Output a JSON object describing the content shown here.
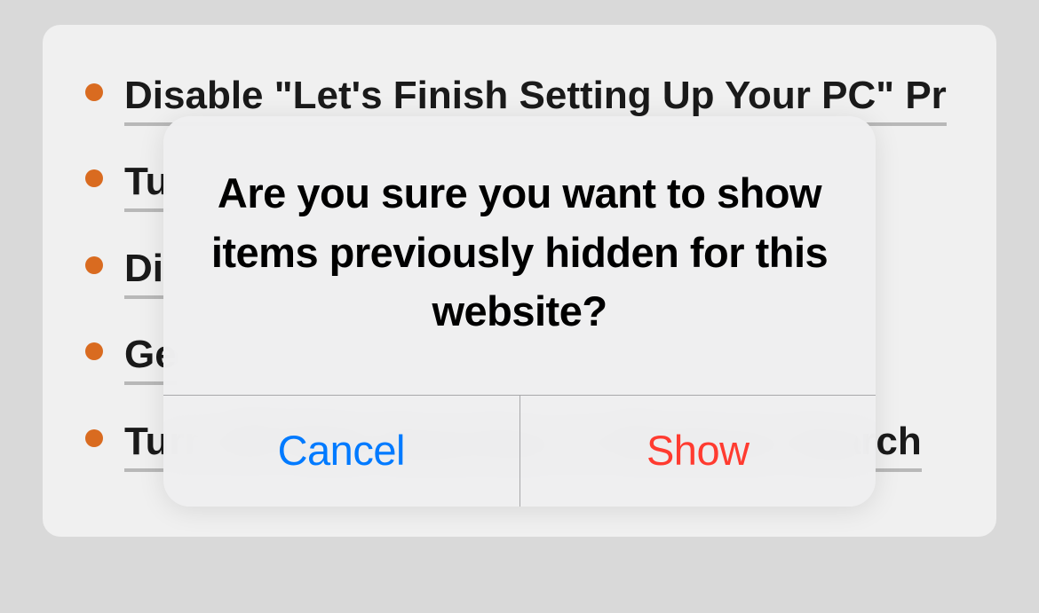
{
  "list": {
    "items": [
      {
        "text": "Disable \"Let's Finish Setting Up Your PC\" Pr"
      },
      {
        "text": "Tu"
      },
      {
        "text": "Di"
      },
      {
        "text": "Ge"
      },
      {
        "text": "Turn Off Web Searches in Windows Search"
      }
    ]
  },
  "modal": {
    "message": "Are you sure you want to show items previously hidden for this website?",
    "cancel_label": "Cancel",
    "confirm_label": "Show"
  }
}
